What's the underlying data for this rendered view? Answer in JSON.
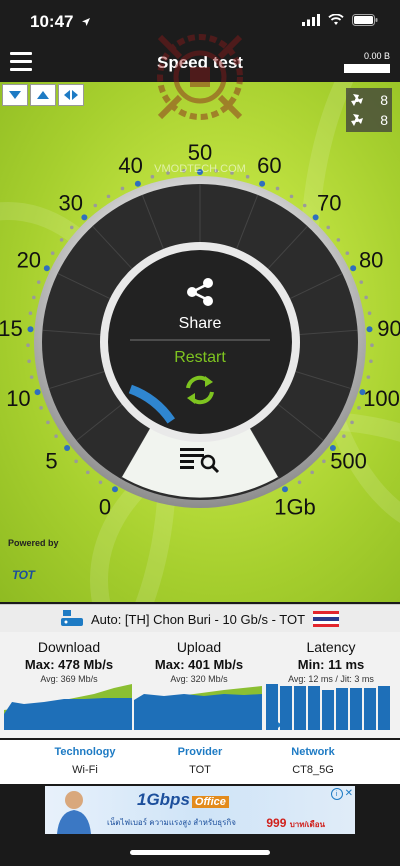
{
  "status": {
    "time": "10:47"
  },
  "header": {
    "title": "Speed test",
    "data_counter": "0.00 B"
  },
  "servers": {
    "count_top": "8",
    "count_bottom": "8"
  },
  "gauge": {
    "scale": [
      "0",
      "5",
      "10",
      "15",
      "20",
      "30",
      "40",
      "50",
      "60",
      "70",
      "80",
      "90",
      "100",
      "500",
      "1Gb"
    ],
    "share_label": "Share",
    "restart_label": "Restart",
    "progress": 0.12,
    "watermark": "VMODTECH.COM"
  },
  "powered": {
    "label": "Powered by",
    "brand": "TOT"
  },
  "server": {
    "text": "Auto: [TH] Chon Buri - 10 Gb/s - TOT"
  },
  "stats": {
    "download": {
      "label": "Download",
      "max": "Max: 478 Mb/s",
      "avg": "Avg: 369 Mb/s"
    },
    "upload": {
      "label": "Upload",
      "max": "Max: 401 Mb/s",
      "avg": "Avg: 320 Mb/s"
    },
    "latency": {
      "label": "Latency",
      "min": "Min: 11 ms",
      "avg": "Avg: 12 ms / Jit: 3 ms"
    }
  },
  "info": {
    "technology": {
      "label": "Technology",
      "value": "Wi-Fi"
    },
    "provider": {
      "label": "Provider",
      "value": "TOT"
    },
    "network": {
      "label": "Network",
      "value": "CT8_5G"
    }
  },
  "ad": {
    "headline": "1Gbps",
    "brand": "Office",
    "price": "999",
    "unit": "บาท/เดือน",
    "text": "เน็ตไฟเบอร์ ความแรงสูง สำหรับธุรกิจ"
  },
  "colors": {
    "accent": "#1e7bc4",
    "restart": "#7ec420",
    "gauge_bg": "#b5d935"
  }
}
